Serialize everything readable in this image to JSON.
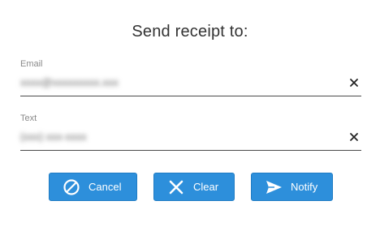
{
  "dialog": {
    "title": "Send receipt to:"
  },
  "fields": {
    "email": {
      "label": "Email",
      "value": "xxxx@xxxxxxxxx.xxx"
    },
    "text": {
      "label": "Text",
      "value": "(xxx) xxx-xxxx"
    }
  },
  "buttons": {
    "cancel": {
      "label": "Cancel",
      "icon": "cancel-circle-icon"
    },
    "clear": {
      "label": "Clear",
      "icon": "x-icon"
    },
    "notify": {
      "label": "Notify",
      "icon": "send-icon"
    }
  },
  "colors": {
    "accent": "#2d8fdb",
    "underline": "#4a4a4a",
    "label": "#8a8a8a"
  }
}
